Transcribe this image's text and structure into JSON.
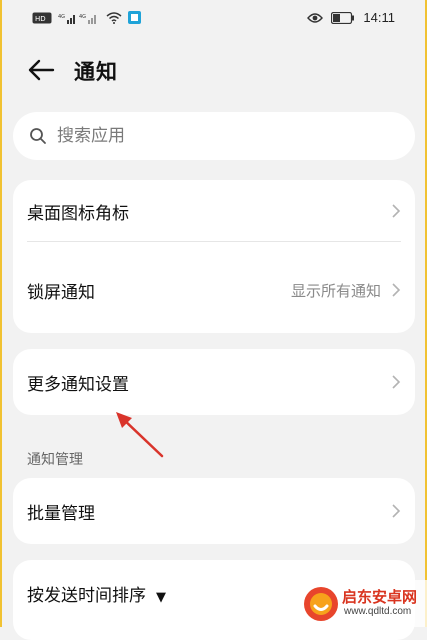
{
  "status_bar": {
    "left": "HD ᵴ⁴ᴳ.ıll ⁴ᴳ.ıll",
    "time": "14:11",
    "icons": [
      "hd-icon",
      "signal-icon",
      "wifi-icon",
      "app-notification-icon",
      "eye-icon",
      "battery-icon"
    ]
  },
  "header": {
    "title": "通知"
  },
  "search": {
    "placeholder": "搜索应用"
  },
  "card1": {
    "items": [
      {
        "label": "桌面图标角标",
        "value": ""
      },
      {
        "label": "锁屏通知",
        "value": "显示所有通知"
      }
    ]
  },
  "card2": {
    "items": [
      {
        "label": "更多通知设置"
      }
    ]
  },
  "section": {
    "title": "通知管理"
  },
  "card3": {
    "items": [
      {
        "label": "批量管理"
      }
    ]
  },
  "card4": {
    "sort_label": "按发送时间排序",
    "sort_arrow": "▼"
  },
  "watermark": {
    "text": "启东安卓网",
    "url": "www.qdltd.com"
  },
  "colors": {
    "background": "#f2f2f2",
    "card": "#ffffff",
    "border_accent": "#f1c232",
    "annotation": "#d9342b",
    "secondary_text": "#8a8a8a"
  }
}
